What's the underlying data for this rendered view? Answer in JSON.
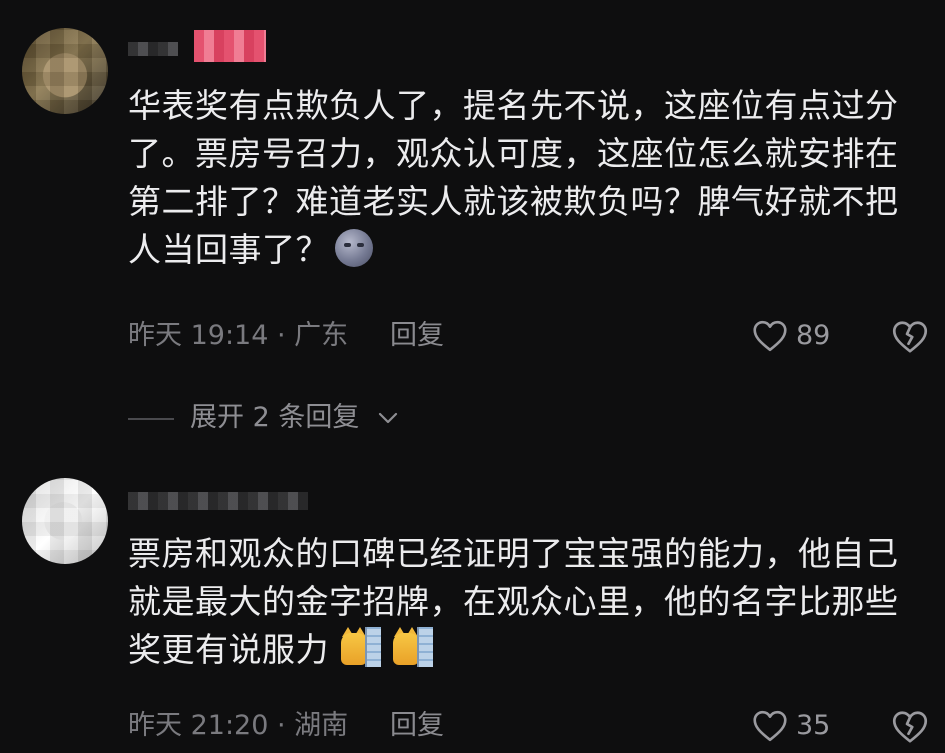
{
  "comments": [
    {
      "lines": [
        "华表奖有点欺负人了，提名先不说，这座位有点过分",
        "了。票房号召力，观众认可度，这座位怎么就安排在",
        "第二排了？难道老实人就该被欺负吗？脾气好就不把",
        "人当回事了？"
      ],
      "emoji": "new-moon-face-icon",
      "time_location": "昨天 19:14 · 广东",
      "reply_label": "回复",
      "like_count": "89"
    },
    {
      "lines": [
        "票房和观众的口碑已经证明了宝宝强的能力，他自己",
        "就是最大的金字招牌，在观众心里，他的名字比那些",
        "奖更有说服力"
      ],
      "emoji": "cat-peeking-wall-icon",
      "time_location": "昨天 21:20 · 湖南",
      "reply_label": "回复",
      "like_count": "35"
    }
  ],
  "expand_replies": {
    "label": "展开 2 条回复"
  },
  "colors": {
    "background": "#0e0e0f",
    "text_primary": "#ececee",
    "text_secondary": "#7a7a7f",
    "username_highlight": "#e4526f"
  }
}
